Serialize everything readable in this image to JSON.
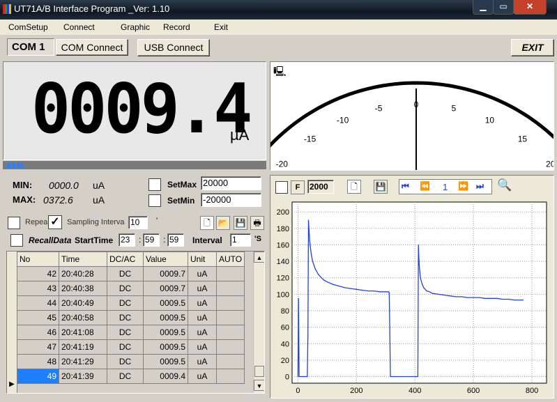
{
  "window": {
    "title": "UT71A/B Interface Program _Ver: 1.10"
  },
  "menu": [
    "ComSetup",
    "Connect",
    "Graphic",
    "Record",
    "Exit"
  ],
  "toolbar": {
    "com_label": "COM 1",
    "com_connect": "COM Connect",
    "usb_connect": "USB Connect",
    "exit": "EXIT"
  },
  "display": {
    "value": "0009.4",
    "unit": "µA"
  },
  "stats": {
    "min_label": "MIN:",
    "min_value": "0000.0",
    "min_unit": "uA",
    "max_label": "MAX:",
    "max_value": "0372.6",
    "max_unit": "uA",
    "setmax_label": "SetMax",
    "setmax_value": "20000",
    "setmin_label": "SetMin",
    "setmin_value": "-20000"
  },
  "record": {
    "repeat_label": "Repea",
    "sampling_label": "Sampling Interva",
    "sampling_value": "10",
    "sampling_unit": "'",
    "recall_label": "RecallData",
    "start_label": "StartTime",
    "start_h": "23",
    "start_m": "59",
    "start_s": "59",
    "interval_label": "Interval",
    "interval_value": "1",
    "interval_unit": "'S"
  },
  "table": {
    "headers": [
      "No",
      "Time",
      "DC/AC",
      "Value",
      "Unit",
      "AUTO"
    ],
    "rows": [
      [
        "42",
        "20:40:28",
        "DC",
        "0009.7",
        "uA",
        ""
      ],
      [
        "43",
        "20:40:38",
        "DC",
        "0009.7",
        "uA",
        ""
      ],
      [
        "44",
        "20:40:49",
        "DC",
        "0009.5",
        "uA",
        ""
      ],
      [
        "45",
        "20:40:58",
        "DC",
        "0009.5",
        "uA",
        ""
      ],
      [
        "46",
        "20:41:08",
        "DC",
        "0009.5",
        "uA",
        ""
      ],
      [
        "47",
        "20:41:19",
        "DC",
        "0009.5",
        "uA",
        ""
      ],
      [
        "48",
        "20:41:29",
        "DC",
        "0009.5",
        "uA",
        ""
      ],
      [
        "49",
        "20:41:39",
        "DC",
        "0009.4",
        "uA",
        ""
      ]
    ]
  },
  "meter": {
    "ticks": [
      "-20",
      "-15",
      "-10",
      "-5",
      "0",
      "5",
      "10",
      "15",
      "20"
    ],
    "needle_value": 0
  },
  "graph_toolbar": {
    "points": "2000",
    "page": "1"
  },
  "chart_data": {
    "type": "line",
    "x_ticks": [
      "0",
      "200",
      "400",
      "600",
      "800"
    ],
    "y_ticks": [
      "0",
      "20",
      "40",
      "60",
      "80",
      "100",
      "120",
      "140",
      "160",
      "180",
      "200"
    ],
    "xlim": [
      -20,
      850
    ],
    "ylim": [
      -8,
      212
    ],
    "grid": true,
    "color": "#2244dd",
    "x": [
      0,
      2,
      4,
      6,
      8,
      10,
      12,
      14,
      16,
      18,
      20,
      22,
      24,
      26,
      28,
      30,
      32,
      34,
      36,
      40,
      45,
      50,
      60,
      70,
      80,
      90,
      100,
      120,
      140,
      160,
      180,
      200,
      220,
      240,
      260,
      280,
      300,
      310,
      312,
      314,
      316,
      318,
      320,
      330,
      340,
      350,
      360,
      370,
      380,
      390,
      400,
      410,
      412,
      414,
      416,
      418,
      420,
      425,
      430,
      440,
      450,
      460,
      480,
      500,
      520,
      540,
      560,
      580,
      600,
      620,
      640,
      660,
      680,
      700,
      720,
      740,
      760,
      770
    ],
    "y": [
      0,
      95,
      0,
      0,
      0,
      0,
      0,
      0,
      0,
      0,
      0,
      0,
      0,
      0,
      0,
      0,
      0,
      50,
      190,
      165,
      150,
      140,
      130,
      124,
      120,
      117,
      115,
      112,
      110,
      108,
      107,
      106,
      105,
      104,
      104,
      103,
      103,
      103,
      102,
      60,
      0,
      0,
      0,
      0,
      0,
      0,
      0,
      0,
      0,
      0,
      0,
      0,
      160,
      140,
      130,
      122,
      118,
      112,
      108,
      104,
      103,
      101,
      100,
      99,
      98,
      97,
      97,
      96,
      96,
      96,
      95,
      95,
      95,
      94,
      94,
      93,
      93,
      93
    ]
  }
}
